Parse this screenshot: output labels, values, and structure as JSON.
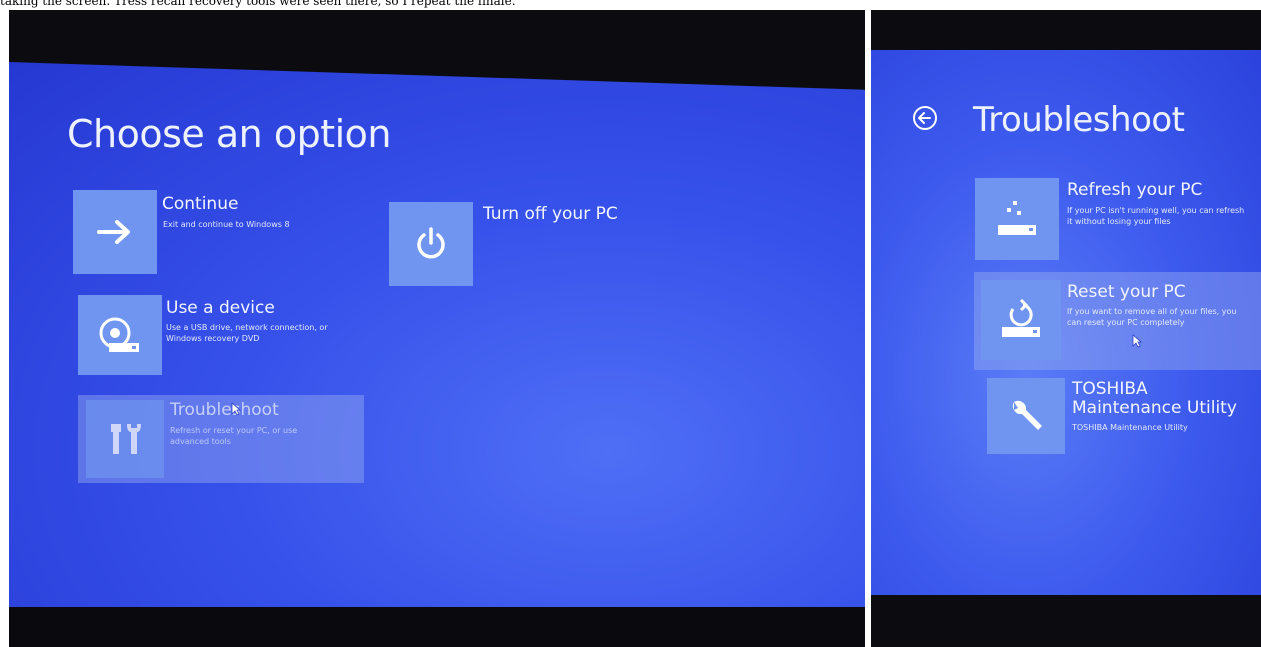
{
  "caption": "taking the screen. Tress recall recovery tools were seen there, so I repeat the finale.",
  "left_screen": {
    "title": "Choose an option",
    "options": [
      {
        "label": "Continue",
        "description": "Exit and continue to Windows 8",
        "icon": "arrow-right-icon"
      },
      {
        "label": "Use a device",
        "description": "Use a USB drive, network connection, or Windows recovery DVD",
        "icon": "disc-drive-icon"
      },
      {
        "label": "Troubleshoot",
        "description": "Refresh or reset your PC, or use advanced tools",
        "icon": "tools-icon"
      },
      {
        "label": "Turn off your PC",
        "description": "",
        "icon": "power-icon"
      }
    ]
  },
  "right_screen": {
    "title": "Troubleshoot",
    "back_icon": "back-arrow-icon",
    "options": [
      {
        "label": "Refresh your PC",
        "description": "If your PC isn't running well, you can refresh it without losing your files",
        "icon": "refresh-pc-icon"
      },
      {
        "label": "Reset your PC",
        "description": "If you want to remove all of your files, you can reset your PC completely",
        "icon": "reset-pc-icon"
      },
      {
        "label": "TOSHIBA Maintenance Utility",
        "description": "TOSHIBA Maintenance Utility",
        "icon": "wrench-icon"
      }
    ]
  },
  "colors": {
    "screen_blue": "#3651ea",
    "tile_blue": "#6f95f0",
    "text": "#eef1ff"
  }
}
